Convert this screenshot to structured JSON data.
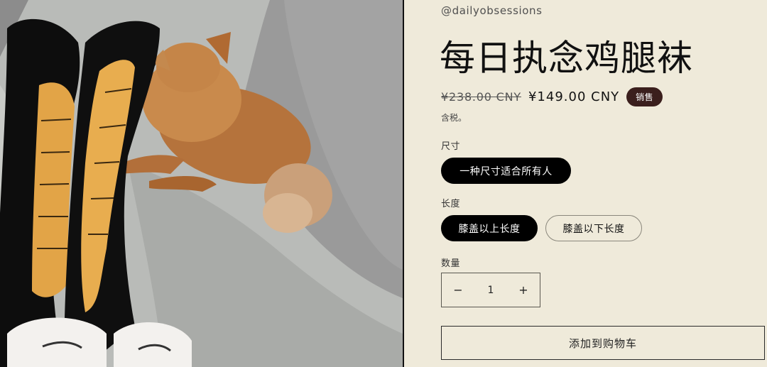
{
  "product": {
    "vendor": "@dailyobsessions",
    "title": "每日执念鸡腿袜",
    "price_regular": "¥238.00 CNY",
    "price_sale": "¥149.00 CNY",
    "sale_badge": "销售",
    "tax_note": "含税。"
  },
  "options": {
    "size": {
      "label": "尺寸",
      "values": [
        "一种尺寸适合所有人"
      ],
      "selected": 0
    },
    "length": {
      "label": "长度",
      "values": [
        "膝盖以上长度",
        "膝盖以下长度"
      ],
      "selected": 0
    }
  },
  "quantity": {
    "label": "数量",
    "value": "1",
    "minus": "−",
    "plus": "+"
  },
  "cart": {
    "add_label": "添加到购物车"
  },
  "colors": {
    "background": "#efeada",
    "sale_badge": "#3b1f1d",
    "selected_pill": "#000000"
  }
}
